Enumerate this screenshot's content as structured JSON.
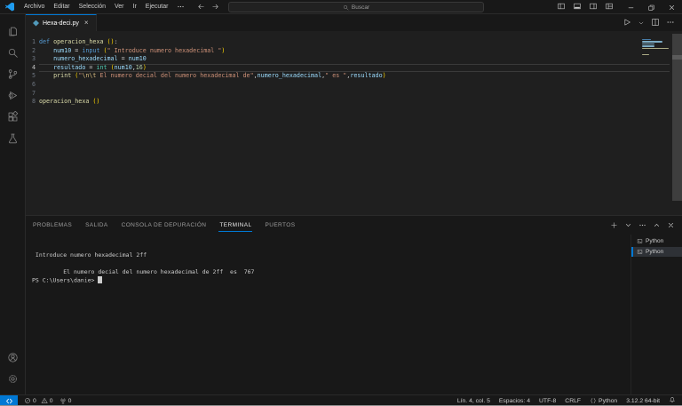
{
  "titlebar": {
    "menu_items": [
      "Archivo",
      "Editar",
      "Selección",
      "Ver",
      "Ir",
      "Ejecutar"
    ],
    "menu_more_icon": "ellipsis",
    "nav_icons": [
      "arrow-left",
      "arrow-right"
    ],
    "search": {
      "label": "Buscar",
      "icon": "search"
    },
    "layout_icons": [
      "layout-sidebar-left",
      "layout-panel",
      "layout-sidebar-right",
      "layout-customize"
    ],
    "window_icons": [
      "minimize",
      "restore",
      "close"
    ]
  },
  "activity_bar": {
    "top": [
      {
        "name": "explorer",
        "icon": "files"
      },
      {
        "name": "search",
        "icon": "search"
      },
      {
        "name": "source-control",
        "icon": "source-control"
      },
      {
        "name": "run-and-debug",
        "icon": "run-debug"
      },
      {
        "name": "extensions",
        "icon": "extensions"
      },
      {
        "name": "testing",
        "icon": "testing"
      }
    ],
    "bottom": [
      {
        "name": "accounts",
        "icon": "account"
      },
      {
        "name": "settings",
        "icon": "gear"
      }
    ]
  },
  "editor": {
    "tab": {
      "label": "Hexa-deci.py",
      "icon": "python-file",
      "icon_color": "#519aba",
      "close_glyph": "×"
    },
    "toolbar": [
      {
        "name": "run-python-file",
        "icon": "play"
      },
      {
        "name": "run-dropdown",
        "icon": "chevron-down"
      },
      {
        "name": "split-editor",
        "icon": "split-editor"
      },
      {
        "name": "more-actions",
        "icon": "ellipsis"
      }
    ],
    "current_line": 4,
    "code_lines": [
      [
        [
          "kw",
          "def"
        ],
        [
          "pl",
          " "
        ],
        [
          "fn",
          "operacion_hexa"
        ],
        [
          "pl",
          " "
        ],
        [
          "p1",
          "()"
        ],
        [
          "pl",
          ":"
        ]
      ],
      [
        [
          "pl",
          "    "
        ],
        [
          "var",
          "num10"
        ],
        [
          "pl",
          " = "
        ],
        [
          "kw",
          "input"
        ],
        [
          "pl",
          " "
        ],
        [
          "p1",
          "("
        ],
        [
          "str",
          "\" Introduce numero hexadecimal \""
        ],
        [
          "p1",
          ")"
        ]
      ],
      [
        [
          "pl",
          "    "
        ],
        [
          "var",
          "numero_hexadecimal"
        ],
        [
          "pl",
          " = "
        ],
        [
          "var",
          "num10"
        ]
      ],
      [
        [
          "pl",
          "    "
        ],
        [
          "var",
          "resultado"
        ],
        [
          "pl",
          " = "
        ],
        [
          "cls",
          "int"
        ],
        [
          "pl",
          " "
        ],
        [
          "p1",
          "("
        ],
        [
          "var",
          "num10"
        ],
        [
          "pl",
          ","
        ],
        [
          "num",
          "16"
        ],
        [
          "p1",
          ")"
        ]
      ],
      [
        [
          "pl",
          "    "
        ],
        [
          "fn",
          "print"
        ],
        [
          "pl",
          " "
        ],
        [
          "p1",
          "("
        ],
        [
          "str",
          "\""
        ],
        [
          "esc",
          "\\n\\t"
        ],
        [
          "str",
          " El numero decial del numero hexadecimal de\""
        ],
        [
          "pl",
          ","
        ],
        [
          "var",
          "numero_hexadecimal"
        ],
        [
          "pl",
          ","
        ],
        [
          "str",
          "\" es \""
        ],
        [
          "pl",
          ","
        ],
        [
          "var",
          "resultado"
        ],
        [
          "p1",
          ")"
        ]
      ],
      [],
      [],
      [
        [
          "fn",
          "operacion_hexa"
        ],
        [
          "pl",
          " "
        ],
        [
          "p1",
          "()"
        ]
      ]
    ]
  },
  "panel": {
    "tabs": [
      {
        "label": "PROBLEMAS",
        "active": false
      },
      {
        "label": "SALIDA",
        "active": false
      },
      {
        "label": "CONSOLA DE DEPURACIÓN",
        "active": false
      },
      {
        "label": "TERMINAL",
        "active": true
      },
      {
        "label": "PUERTOS",
        "active": false
      }
    ],
    "actions": [
      {
        "name": "new-terminal",
        "icon": "add"
      },
      {
        "name": "launch-profile",
        "icon": "chevron-down"
      },
      {
        "name": "terminal-more",
        "icon": "ellipsis"
      },
      {
        "name": "maximize-panel",
        "icon": "chevron-up"
      },
      {
        "name": "close-panel",
        "icon": "close"
      }
    ],
    "terminal": {
      "lines": [
        "",
        " Introduce numero hexadecimal 2ff",
        "",
        "         El numero decial del numero hexadecimal de 2ff  es  767"
      ],
      "prompt": "PS C:\\Users\\danie> "
    },
    "terminal_list": [
      {
        "label": "Python",
        "icon": "terminal",
        "active": false
      },
      {
        "label": "Python",
        "icon": "terminal",
        "active": true
      }
    ]
  },
  "status_bar": {
    "accent": "#0078d4",
    "remote_icon": "remote",
    "errors": "0",
    "warnings": "0",
    "ports": "0",
    "right_items": [
      {
        "name": "cursor-position",
        "label": "Lín. 4, col. 5"
      },
      {
        "name": "indentation",
        "label": "Espacios: 4"
      },
      {
        "name": "encoding",
        "label": "UTF-8"
      },
      {
        "name": "end-of-line",
        "label": "CRLF"
      },
      {
        "name": "language-mode",
        "label": "Python",
        "icon": "braces"
      },
      {
        "name": "python-interpreter",
        "label": "3.12.2 64-bit"
      }
    ],
    "bell_icon": "bell"
  }
}
